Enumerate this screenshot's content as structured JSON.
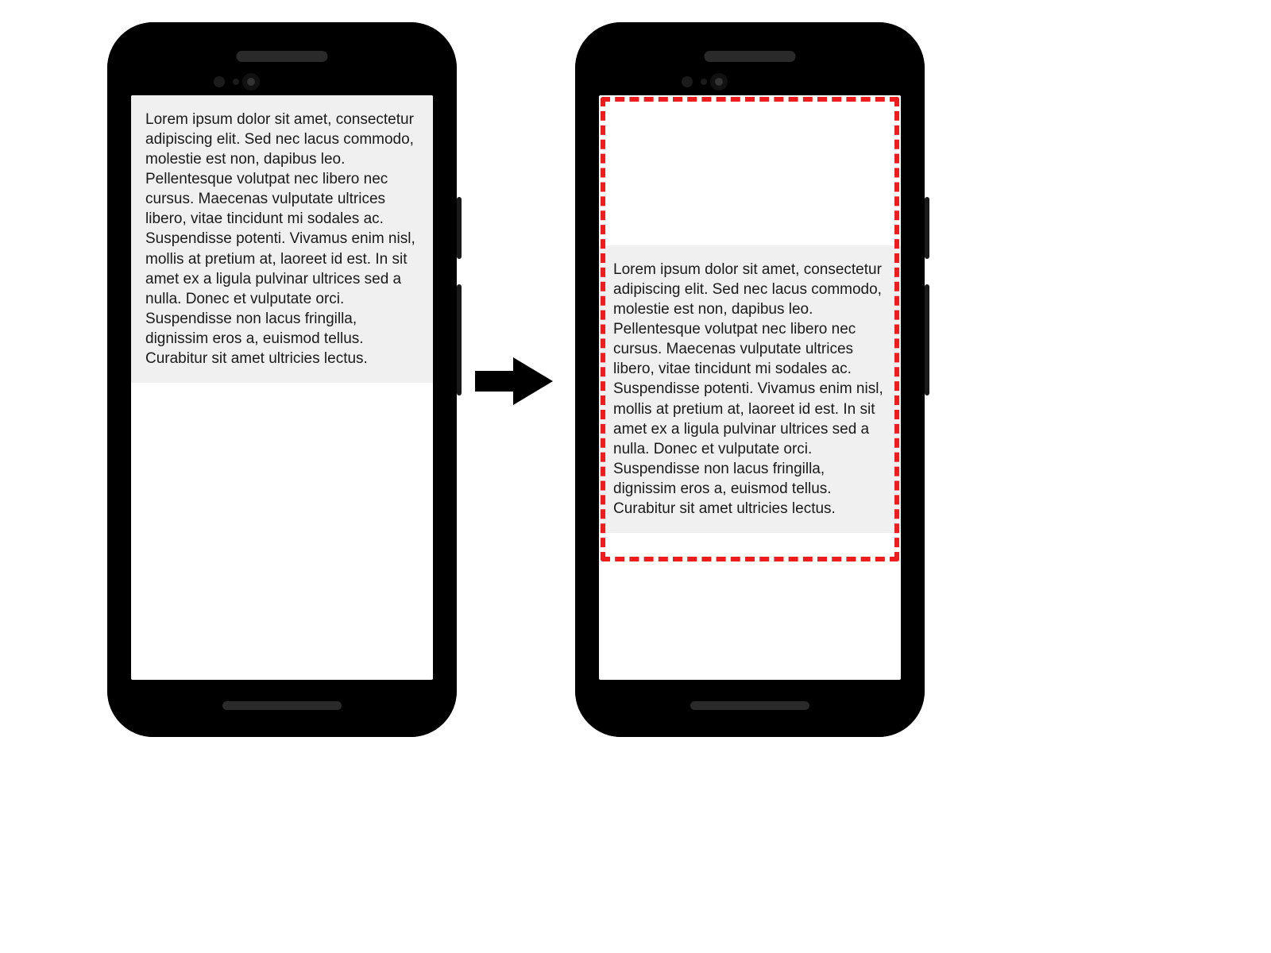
{
  "lorem_text": "Lorem ipsum dolor sit amet, consectetur adipiscing elit. Sed nec lacus commodo, molestie est non, dapibus leo. Pellentesque volutpat nec libero nec cursus. Maecenas vulputate ultrices libero, vitae tincidunt mi sodales ac. Suspendisse potenti. Vivamus enim nisl, mollis at pretium at, laoreet id est. In sit amet ex a ligula pulvinar ultrices sed a nulla. Donec et vulputate orci. Suspendisse non lacus fringilla, dignissim eros a, euismod tellus. Curabitur sit amet ultricies lectus.",
  "colors": {
    "highlight_border": "#ee1c1c",
    "text_bg": "#f0f0f0",
    "phone_body": "#000000",
    "screen_bg": "#ffffff"
  }
}
